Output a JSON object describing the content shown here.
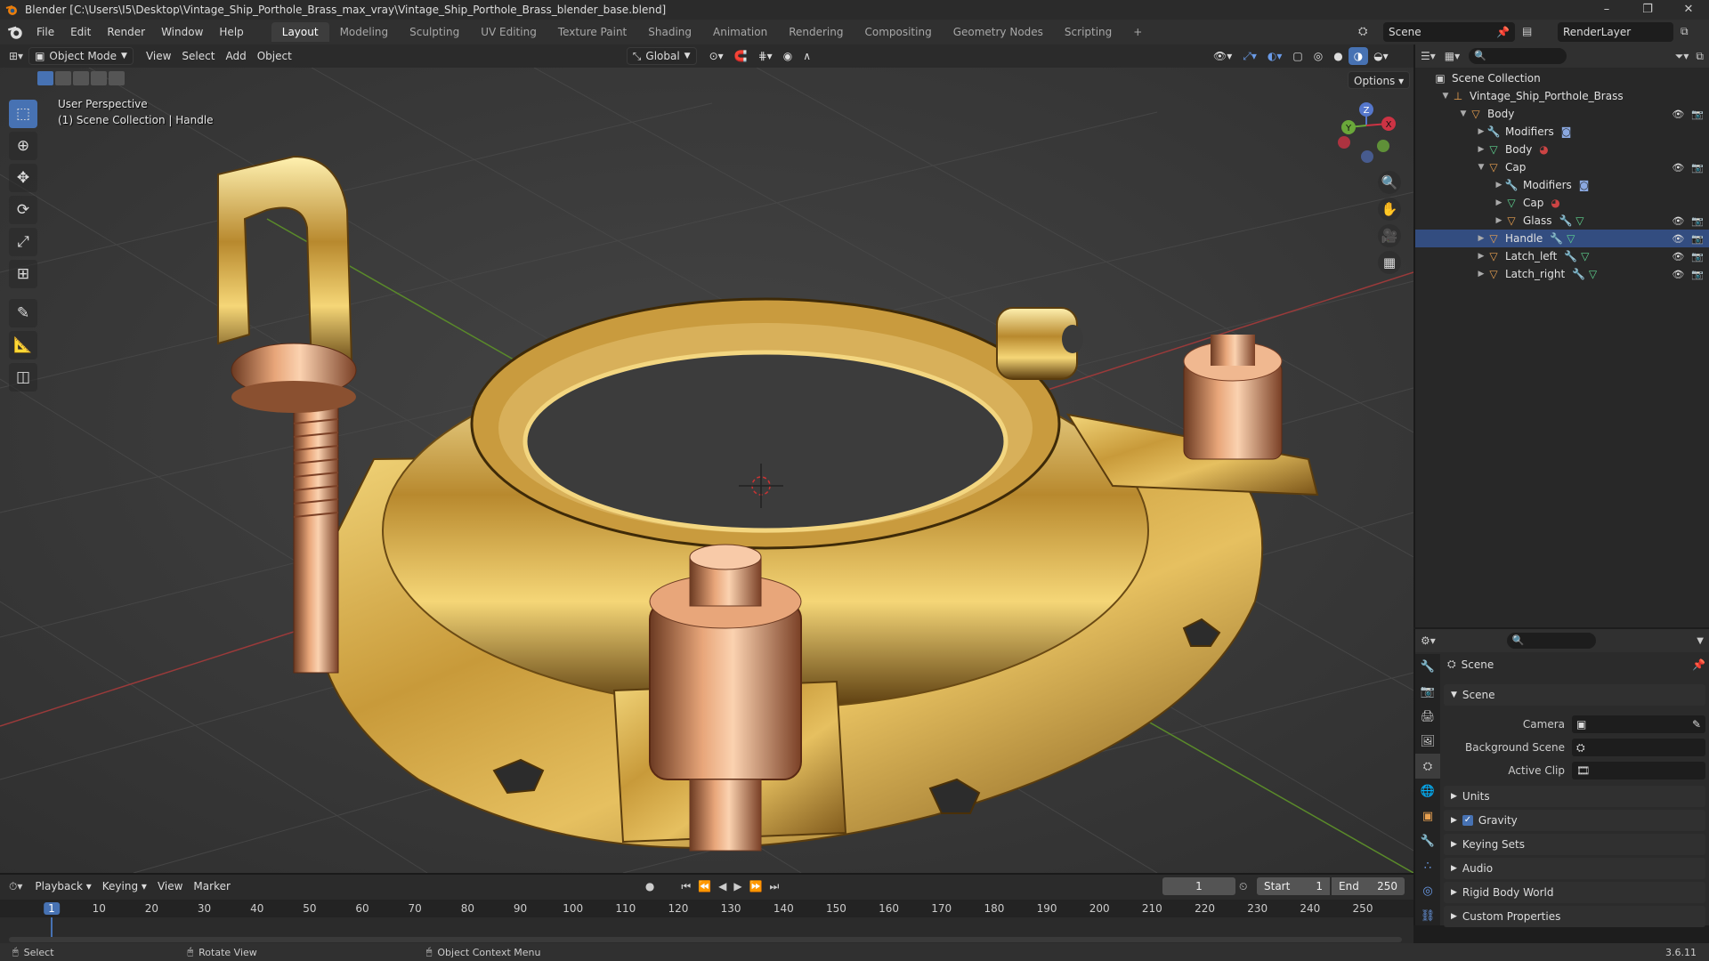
{
  "window": {
    "title": "Blender [C:\\Users\\I5\\Desktop\\Vintage_Ship_Porthole_Brass_max_vray\\Vintage_Ship_Porthole_Brass_blender_base.blend]",
    "controls": [
      "–",
      "❐",
      "✕"
    ]
  },
  "menus": [
    "File",
    "Edit",
    "Render",
    "Window",
    "Help"
  ],
  "workspaces": [
    {
      "label": "Layout",
      "active": true
    },
    {
      "label": "Modeling"
    },
    {
      "label": "Sculpting"
    },
    {
      "label": "UV Editing"
    },
    {
      "label": "Texture Paint"
    },
    {
      "label": "Shading"
    },
    {
      "label": "Animation"
    },
    {
      "label": "Rendering"
    },
    {
      "label": "Compositing"
    },
    {
      "label": "Geometry Nodes"
    },
    {
      "label": "Scripting"
    }
  ],
  "add_workspace": "+",
  "scene_field": "Scene",
  "view_layer_field": "RenderLayer",
  "viewport_header": {
    "mode": "Object Mode",
    "menus": [
      "View",
      "Select",
      "Add",
      "Object"
    ],
    "orientation": "Global",
    "options": "Options"
  },
  "viewport": {
    "perspective": "User Perspective",
    "collection_info": "(1) Scene Collection | Handle"
  },
  "gizmo": {
    "x": "X",
    "y": "Y",
    "z": "Z"
  },
  "tools": [
    {
      "name": "select-box-tool",
      "glyph": "⬚",
      "active": true
    },
    {
      "name": "cursor-tool",
      "glyph": "⊕"
    },
    {
      "name": "move-tool",
      "glyph": "✥"
    },
    {
      "name": "rotate-tool",
      "glyph": "⟳"
    },
    {
      "name": "scale-tool",
      "glyph": "⤢"
    },
    {
      "name": "transform-tool",
      "glyph": "⊞"
    },
    {
      "name": "annotate-tool",
      "glyph": "✎"
    },
    {
      "name": "measure-tool",
      "glyph": "📐"
    },
    {
      "name": "add-cube-tool",
      "glyph": "◫"
    }
  ],
  "outliner": {
    "rows": [
      {
        "label": "Scene Collection",
        "indent": 0,
        "icon": "▣",
        "color": "#cccccc",
        "expanded": true,
        "vis": false
      },
      {
        "label": "Vintage_Ship_Porthole_Brass",
        "indent": 1,
        "icon": "⊥",
        "color": "#e8a050",
        "expanded": true,
        "vis": false
      },
      {
        "label": "Body",
        "indent": 2,
        "icon": "▽",
        "color": "#e8a050",
        "expanded": true,
        "vis": true
      },
      {
        "label": "Modifiers",
        "indent": 3,
        "icon": "🔧",
        "color": "#6a9be8",
        "expanded": false,
        "vis": false,
        "badge": "modifier-badge"
      },
      {
        "label": "Body",
        "indent": 3,
        "icon": "▽",
        "color": "#5fd490",
        "expanded": false,
        "vis": false,
        "badge": "material-badge"
      },
      {
        "label": "Cap",
        "indent": 3,
        "icon": "▽",
        "color": "#e8a050",
        "expanded": true,
        "vis": true
      },
      {
        "label": "Modifiers",
        "indent": 4,
        "icon": "🔧",
        "color": "#6a9be8",
        "expanded": false,
        "vis": false,
        "badge": "modifier-badge"
      },
      {
        "label": "Cap",
        "indent": 4,
        "icon": "▽",
        "color": "#5fd490",
        "expanded": false,
        "vis": false,
        "badge": "material-badge"
      },
      {
        "label": "Glass",
        "indent": 4,
        "icon": "▽",
        "color": "#e8a050",
        "expanded": false,
        "vis": true,
        "badge": "mesh-badges"
      },
      {
        "label": "Handle",
        "indent": 3,
        "icon": "▽",
        "color": "#e8a050",
        "expanded": false,
        "vis": true,
        "badge": "mesh-badges",
        "selected": true
      },
      {
        "label": "Latch_left",
        "indent": 3,
        "icon": "▽",
        "color": "#e8a050",
        "expanded": false,
        "vis": true,
        "badge": "mesh-badges"
      },
      {
        "label": "Latch_right",
        "indent": 3,
        "icon": "▽",
        "color": "#e8a050",
        "expanded": false,
        "vis": true,
        "badge": "mesh-badges"
      }
    ]
  },
  "properties": {
    "context": "Scene",
    "panel": "Scene",
    "fields": [
      {
        "label": "Camera",
        "value": ""
      },
      {
        "label": "Background Scene",
        "value": ""
      },
      {
        "label": "Active Clip",
        "value": ""
      }
    ],
    "sections": [
      {
        "label": "Units",
        "checkbox": false
      },
      {
        "label": "Gravity",
        "checkbox": true
      },
      {
        "label": "Keying Sets",
        "checkbox": false
      },
      {
        "label": "Audio",
        "checkbox": false
      },
      {
        "label": "Rigid Body World",
        "checkbox": false
      },
      {
        "label": "Custom Properties",
        "checkbox": false
      }
    ]
  },
  "timeline": {
    "menus": [
      "Playback",
      "Keying",
      "View",
      "Marker"
    ],
    "current_frame": "1",
    "start_label": "Start",
    "start": "1",
    "end_label": "End",
    "end": "250",
    "ticks": [
      "1",
      "10",
      "20",
      "30",
      "40",
      "50",
      "60",
      "70",
      "80",
      "90",
      "100",
      "110",
      "120",
      "130",
      "140",
      "150",
      "160",
      "170",
      "180",
      "190",
      "200",
      "210",
      "220",
      "230",
      "240",
      "250"
    ]
  },
  "statusbar": {
    "select": "Select",
    "rotate": "Rotate View",
    "context": "Object Context Menu",
    "version": "3.6.11"
  }
}
